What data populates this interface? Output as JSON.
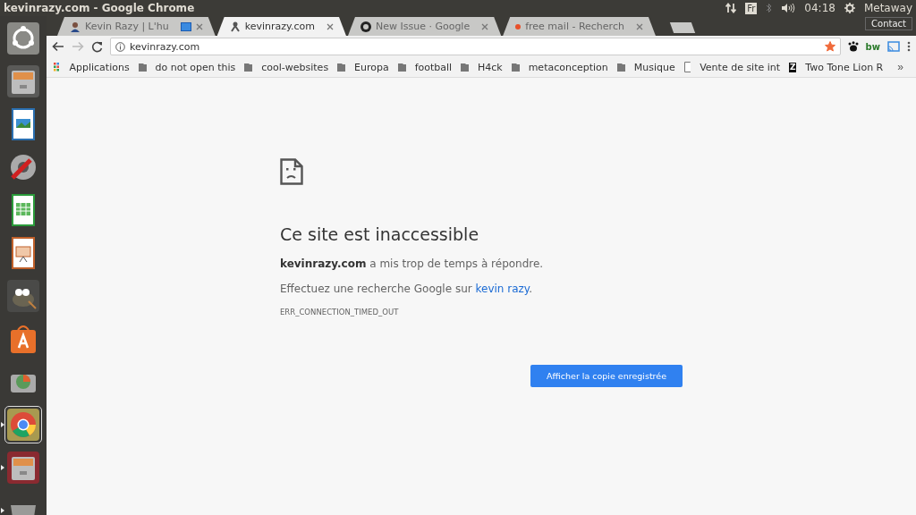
{
  "window": {
    "title": "kevinrazy.com - Google Chrome"
  },
  "top_panel": {
    "keyboard": "Fr",
    "time": "04:18",
    "user": "Metaway"
  },
  "launcher": [
    {
      "kind": "ubuntu",
      "selected": false,
      "running": false
    },
    {
      "kind": "files",
      "selected": false,
      "running": false
    },
    {
      "kind": "impress-image",
      "selected": false,
      "running": false
    },
    {
      "kind": "settings",
      "selected": false,
      "running": false
    },
    {
      "kind": "calc",
      "selected": false,
      "running": false
    },
    {
      "kind": "impress",
      "selected": false,
      "running": false
    },
    {
      "kind": "gimp",
      "selected": false,
      "running": false
    },
    {
      "kind": "store",
      "selected": false,
      "running": false
    },
    {
      "kind": "disk",
      "selected": false,
      "running": false
    },
    {
      "kind": "chrome",
      "selected": true,
      "running": true
    },
    {
      "kind": "files-red",
      "selected": false,
      "running": true
    },
    {
      "kind": "trash",
      "selected": false,
      "running": true
    }
  ],
  "tabs": [
    {
      "label": "Kevin Razy | L'hu",
      "kind": "person",
      "casting": true,
      "selected": false
    },
    {
      "label": "kevinrazy.com",
      "kind": "server",
      "casting": false,
      "selected": true
    },
    {
      "label": "New Issue · Google",
      "kind": "github",
      "casting": false,
      "selected": false
    },
    {
      "label": "free mail - Recherch",
      "kind": "dot",
      "casting": false,
      "selected": false
    }
  ],
  "contact_button": "Contact",
  "toolbar": {
    "back_disabled": false,
    "forward_disabled": true,
    "url": "kevinrazy.com",
    "bookmarked": true,
    "extensions": [
      {
        "kind": "paw"
      },
      {
        "kind": "text",
        "label": "bw"
      },
      {
        "kind": "cast"
      }
    ]
  },
  "bookmarks": [
    {
      "kind": "apps",
      "label": "Applications"
    },
    {
      "kind": "folder",
      "label": "do not open this"
    },
    {
      "kind": "folder",
      "label": "cool-websites"
    },
    {
      "kind": "folder",
      "label": "Europa"
    },
    {
      "kind": "folder",
      "label": "football"
    },
    {
      "kind": "folder",
      "label": "H4ck"
    },
    {
      "kind": "folder",
      "label": "metaconception"
    },
    {
      "kind": "folder",
      "label": "Musique"
    },
    {
      "kind": "page",
      "label": "Vente de site int"
    },
    {
      "kind": "letter",
      "favicon_text": "Z",
      "label": "Two Tone Lion R"
    }
  ],
  "bookmarks_more": "»",
  "error": {
    "heading": "Ce site est inaccessible",
    "message": "**kevinrazy.com** a mis trop de temps à répondre.",
    "search_text": "Effectuez une recherche Google sur",
    "search_link": "kevin razy",
    "search_end": ".",
    "code": "ERR_CONNECTION_TIMED_OUT",
    "button": "Afficher la copie enregistrée"
  }
}
